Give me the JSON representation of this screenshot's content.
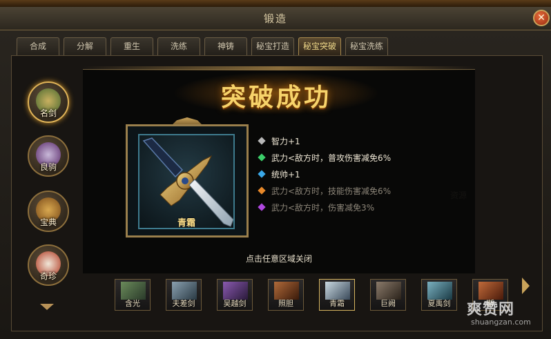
{
  "window": {
    "title": "锻造",
    "close_icon": "close-icon"
  },
  "tabs": [
    {
      "label": "合成"
    },
    {
      "label": "分解"
    },
    {
      "label": "重生"
    },
    {
      "label": "洗练"
    },
    {
      "label": "神铸"
    },
    {
      "label": "秘宝打造"
    },
    {
      "label": "秘宝突破",
      "active": true
    },
    {
      "label": "秘宝洗练"
    }
  ],
  "categories": [
    {
      "label": "名剑",
      "icon": "sword-icon",
      "active": true
    },
    {
      "label": "良驹",
      "icon": "horse-icon"
    },
    {
      "label": "宝典",
      "icon": "book-icon"
    },
    {
      "label": "奇珍",
      "icon": "feather-fan-icon"
    }
  ],
  "background_text": "资源",
  "strip": [
    {
      "label": "含光"
    },
    {
      "label": "夫差剑"
    },
    {
      "label": "吴越剑"
    },
    {
      "label": "照胆"
    },
    {
      "label": "青霜",
      "selected": true
    },
    {
      "label": "巨阙"
    },
    {
      "label": "夏禹剑"
    },
    {
      "label": "断"
    }
  ],
  "popup": {
    "banner": "突破成功",
    "item_name": "青霜",
    "item_icon": "sword-icon",
    "stats": [
      {
        "text": "智力+1",
        "gem": "#b8b8b8",
        "active": true
      },
      {
        "text": "武力<敌方时，普攻伤害减免6%",
        "gem": "#3ccf6a",
        "active": true
      },
      {
        "text": "统帅+1",
        "gem": "#3aa8e8",
        "active": true
      },
      {
        "text": "武力<敌方时，技能伤害减免6%",
        "gem": "#e8892a",
        "active": false
      },
      {
        "text": "武力<敌方时，伤害减免3%",
        "gem": "#b048e0",
        "active": false
      }
    ],
    "close_hint": "点击任意区域关闭"
  },
  "watermark": {
    "main": "爽赞网",
    "sub": "shuangzan.com"
  }
}
